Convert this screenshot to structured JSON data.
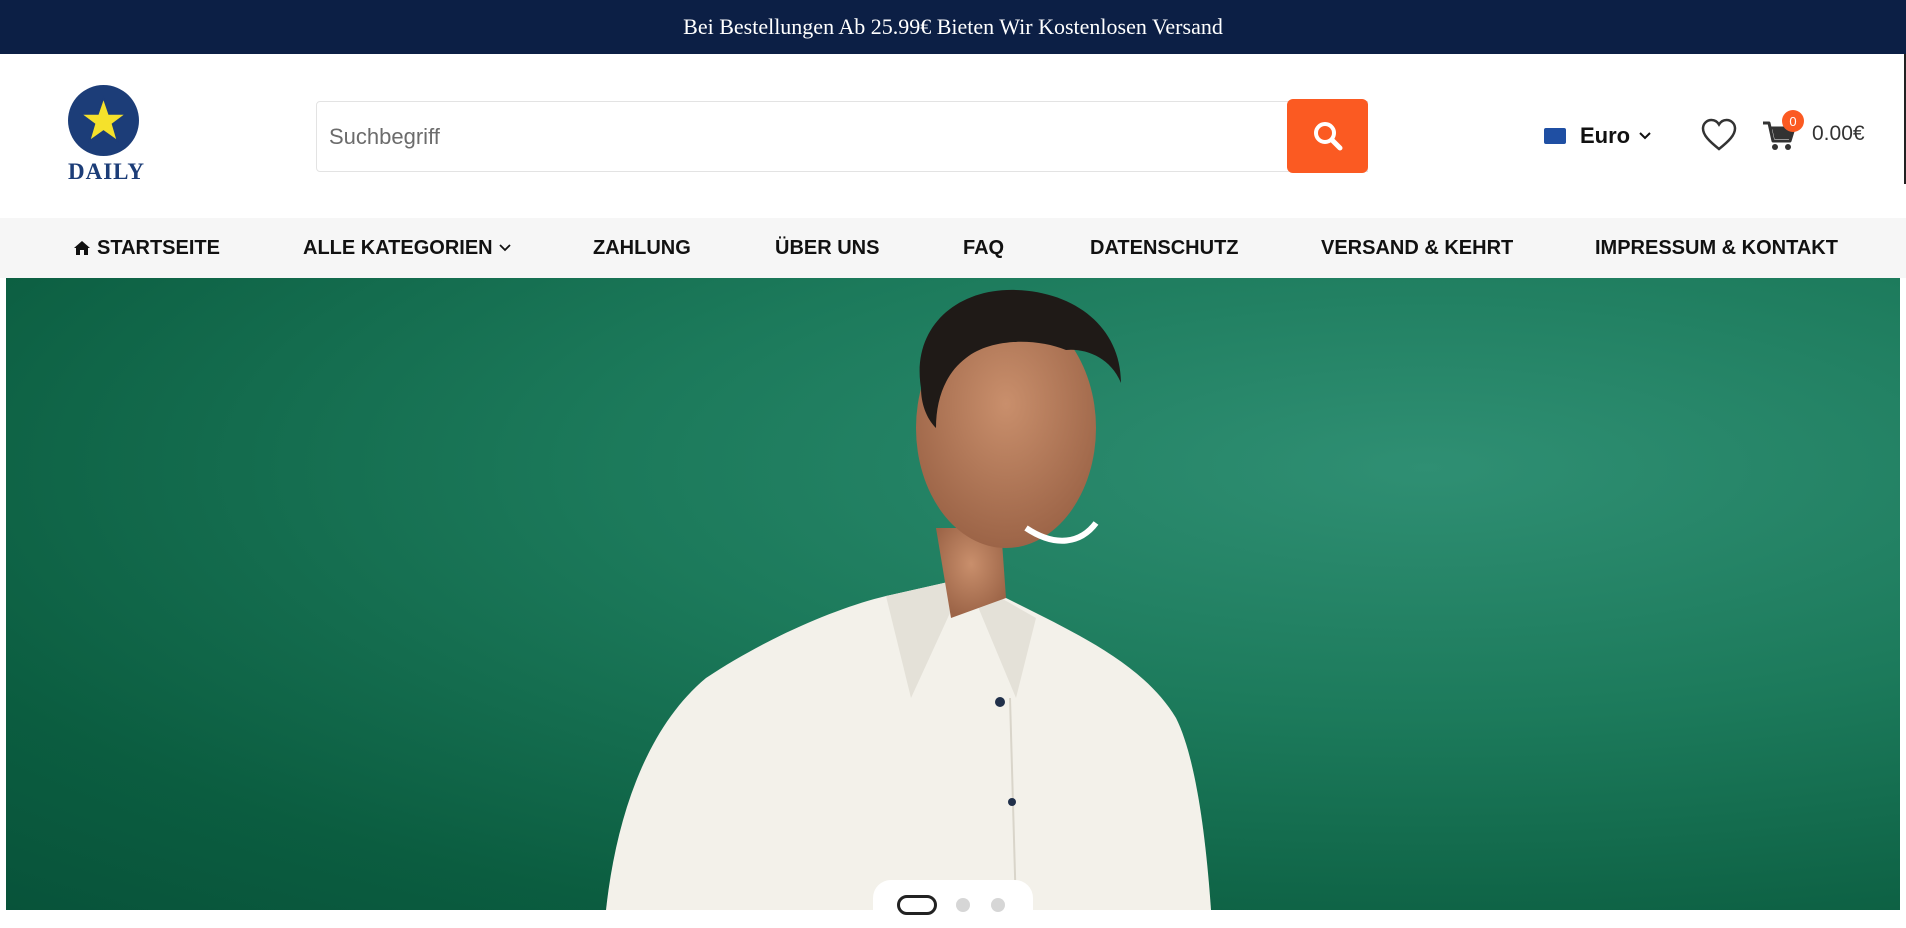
{
  "announcement": "Bei Bestellungen Ab 25.99€ Bieten Wir Kostenlosen Versand",
  "logo": {
    "icon": "star-icon",
    "text": "DAILY"
  },
  "search": {
    "placeholder": "Suchbegriff",
    "button_icon": "search-icon"
  },
  "currency": {
    "flag_icon": "eu-flag-icon",
    "label": "Euro",
    "chevron_icon": "chevron-down-icon"
  },
  "wishlist": {
    "icon": "heart-icon"
  },
  "cart": {
    "icon": "cart-icon",
    "count": "0",
    "total": "0.00€"
  },
  "nav": [
    {
      "label": "STARTSEITE",
      "icon": "home-icon"
    },
    {
      "label": "ALLE KATEGORIEN",
      "icon": "chevron-down-icon"
    },
    {
      "label": "ZAHLUNG"
    },
    {
      "label": "ÜBER UNS"
    },
    {
      "label": "FAQ"
    },
    {
      "label": "DATENSCHUTZ"
    },
    {
      "label": "VERSAND & KEHRT"
    },
    {
      "label": "IMPRESSUM & KONTAKT"
    }
  ],
  "hero": {
    "slides": 3,
    "active_slide": 1
  },
  "colors": {
    "brand_navy": "#0c1f45",
    "accent_orange": "#fb5a22",
    "hero_green": "#1c7a5b"
  }
}
